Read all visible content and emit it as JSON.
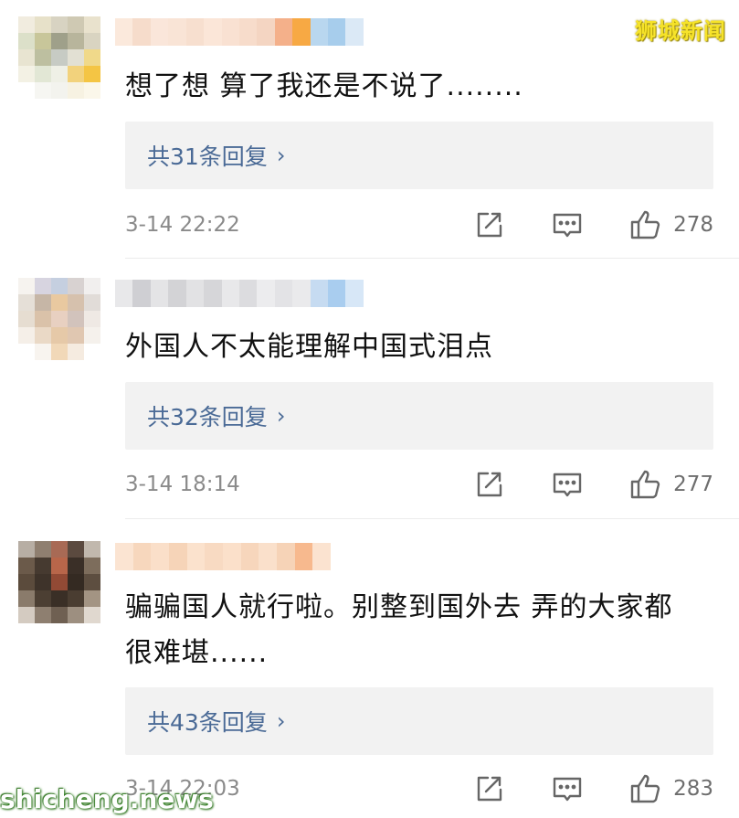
{
  "watermark": "狮城新闻",
  "site_watermark": "shicheng.news",
  "comments": [
    {
      "text": "想了想 算了我还是不说了........",
      "replies": "共31条回复",
      "time": "3-14 22:22",
      "likes": "278"
    },
    {
      "text": "外国人不太能理解中国式泪点",
      "replies": "共32条回复",
      "time": "3-14 18:14",
      "likes": "277"
    },
    {
      "text": "骗骗国人就行啦。别整到国外去 弄的大家都很难堪......",
      "replies": "共43条回复",
      "time": "3-14 22:03",
      "likes": "283"
    }
  ],
  "icons": {
    "chevron": "›",
    "share": "share-icon",
    "message": "message-icon",
    "like": "thumbs-up-icon"
  },
  "colors": {
    "reply_link": "#4a6a96",
    "reply_bg": "#f2f2f2",
    "timestamp": "#8a8a8a",
    "watermark": "#f6e32a"
  }
}
